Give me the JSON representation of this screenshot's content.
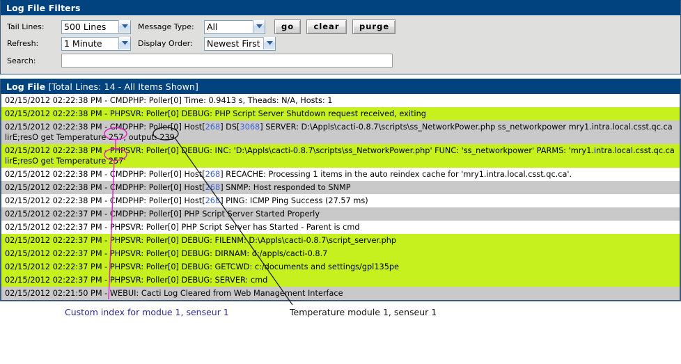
{
  "filters": {
    "title": "Log File Filters",
    "tail_lines_label": "Tail Lines:",
    "tail_lines_value": "500 Lines",
    "message_type_label": "Message Type:",
    "message_type_value": "All",
    "refresh_label": "Refresh:",
    "refresh_value": "1 Minute",
    "display_order_label": "Display Order:",
    "display_order_value": "Newest First",
    "search_label": "Search:",
    "search_value": "",
    "search_placeholder": "",
    "go_label": "go",
    "clear_label": "clear",
    "purge_label": "purge",
    "icons": {
      "dropdown": "chevron-down-icon"
    }
  },
  "log": {
    "title": "Log File",
    "title_suffix": "[Total Lines: 14 - All Items Shown]",
    "rows": [
      {
        "bg": "white",
        "text": "02/15/2012 02:22:38 PM - CMDPHP: Poller[0] Time: 0.9413 s, Theads: N/A, Hosts: 1"
      },
      {
        "bg": "green",
        "text": "02/15/2012 02:22:38 PM - PHPSVR: Poller[0] DEBUG: PHP Script Server Shutdown request received, exiting"
      },
      {
        "bg": "gray",
        "text": "02/15/2012 02:22:38 PM - CMDPHP: Poller[0] Host[268] DS[3068] SERVER: D:\\Appls\\cacti-0.8.7\\scripts\\ss_NetworkPower.php ss_networkpower mry1.intra.local.csst.qc.ca lirE;resO get Temperature 257, output: 239"
      },
      {
        "bg": "green",
        "text": "02/15/2012 02:22:38 PM - PHPSVR: Poller[0] DEBUG: INC: 'D:\\Appls\\cacti-0.8.7\\scripts\\ss_NetworkPower.php' FUNC: 'ss_networkpower' PARMS: 'mry1.intra.local.csst.qc.ca lirE;resO get Temperature 257'"
      },
      {
        "bg": "white",
        "text": "02/15/2012 02:22:38 PM - CMDPHP: Poller[0] Host[268] RECACHE: Processing 1 items in the auto reindex cache for 'mry1.intra.local.csst.qc.ca'."
      },
      {
        "bg": "gray",
        "text": "02/15/2012 02:22:38 PM - CMDPHP: Poller[0] Host[268] SNMP: Host responded to SNMP"
      },
      {
        "bg": "white",
        "text": "02/15/2012 02:22:38 PM - CMDPHP: Poller[0] Host[268] PING: ICMP Ping Success (27.57 ms)"
      },
      {
        "bg": "gray",
        "text": "02/15/2012 02:22:37 PM - CMDPHP: Poller[0] PHP Script Server Started Properly"
      },
      {
        "bg": "white",
        "text": "02/15/2012 02:22:37 PM - PHPSVR: Poller[0] PHP Script Server has Started - Parent is cmd"
      },
      {
        "bg": "green",
        "text": "02/15/2012 02:22:37 PM - PHPSVR: Poller[0] DEBUG: FILENM: D:\\Appls\\cacti-0.8.7\\script_server.php"
      },
      {
        "bg": "green",
        "text": "02/15/2012 02:22:37 PM - PHPSVR: Poller[0] DEBUG: DIRNAM: d:/appls/cacti-0.8.7"
      },
      {
        "bg": "green",
        "text": "02/15/2012 02:22:37 PM - PHPSVR: Poller[0] DEBUG: GETCWD: c:/documents and settings/gpl135pe"
      },
      {
        "bg": "green",
        "text": "02/15/2012 02:22:37 PM - PHPSVR: Poller[0] DEBUG: SERVER: cmd"
      },
      {
        "bg": "gray",
        "text": "02/15/2012 02:21:50 PM - WEBUI: Cacti Log Cleared from Web Management Interface"
      }
    ]
  },
  "annotations": {
    "custom_index": "Custom index for modue 1, senseur 1",
    "temperature": "Temperature module 1, senseur 1",
    "circled_values": {
      "index_value": "257",
      "output_value": "239"
    },
    "colors": {
      "index_marker": "#e41ec8",
      "output_marker": "#111111",
      "annotation_text": "#2a2a8c",
      "header_bar": "#00437f",
      "row_green": "#c6f01e",
      "row_gray": "#c9c9c9"
    }
  }
}
